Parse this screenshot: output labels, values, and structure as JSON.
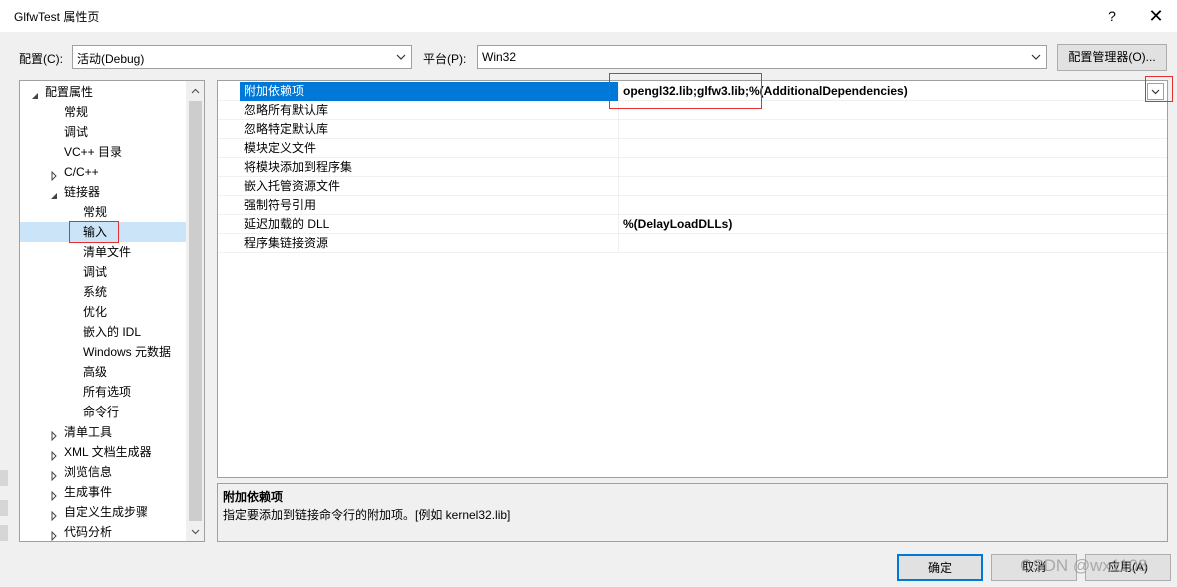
{
  "window": {
    "title": "GlfwTest 属性页",
    "help_glyph": "?",
    "close_glyph": "✕"
  },
  "config": {
    "config_label": "配置(C):",
    "config_value": "活动(Debug)",
    "platform_label": "平台(P):",
    "platform_value": "Win32",
    "manager_button": "配置管理器(O)..."
  },
  "tree": {
    "items": [
      {
        "label": "配置属性",
        "expander": "expanded"
      },
      {
        "label": "常规",
        "expander": "none"
      },
      {
        "label": "调试",
        "expander": "none"
      },
      {
        "label": "VC++ 目录",
        "expander": "none"
      },
      {
        "label": "C/C++",
        "expander": "collapsed"
      },
      {
        "label": "链接器",
        "expander": "expanded"
      },
      {
        "label": "常规",
        "expander": "none"
      },
      {
        "label": "输入",
        "expander": "none",
        "selected": true
      },
      {
        "label": "清单文件",
        "expander": "none"
      },
      {
        "label": "调试",
        "expander": "none"
      },
      {
        "label": "系统",
        "expander": "none"
      },
      {
        "label": "优化",
        "expander": "none"
      },
      {
        "label": "嵌入的 IDL",
        "expander": "none"
      },
      {
        "label": "Windows 元数据",
        "expander": "none"
      },
      {
        "label": "高级",
        "expander": "none"
      },
      {
        "label": "所有选项",
        "expander": "none"
      },
      {
        "label": "命令行",
        "expander": "none"
      },
      {
        "label": "清单工具",
        "expander": "collapsed"
      },
      {
        "label": "XML 文档生成器",
        "expander": "collapsed"
      },
      {
        "label": "浏览信息",
        "expander": "collapsed"
      },
      {
        "label": "生成事件",
        "expander": "collapsed"
      },
      {
        "label": "自定义生成步骤",
        "expander": "collapsed"
      },
      {
        "label": "代码分析",
        "expander": "collapsed"
      }
    ]
  },
  "grid": {
    "rows": [
      {
        "name": "附加依赖项",
        "value": "opengl32.lib;glfw3.lib;%(AdditionalDependencies)",
        "selected": true
      },
      {
        "name": "忽略所有默认库",
        "value": ""
      },
      {
        "name": "忽略特定默认库",
        "value": ""
      },
      {
        "name": "模块定义文件",
        "value": ""
      },
      {
        "name": "将模块添加到程序集",
        "value": ""
      },
      {
        "name": "嵌入托管资源文件",
        "value": ""
      },
      {
        "name": "强制符号引用",
        "value": ""
      },
      {
        "name": "延迟加载的 DLL",
        "value": "%(DelayLoadDLLs)"
      },
      {
        "name": "程序集链接资源",
        "value": ""
      }
    ]
  },
  "description": {
    "title": "附加依赖项",
    "text": "指定要添加到链接命令行的附加项。[例如 kernel32.lib]"
  },
  "buttons": {
    "ok": "确定",
    "cancel": "取消",
    "apply": "应用(A)"
  },
  "watermark": "CSDN @wx1108",
  "colors": {
    "selection": "#0078d7",
    "tree_selection": "#cce4f7",
    "highlight_box": "#e03030"
  }
}
